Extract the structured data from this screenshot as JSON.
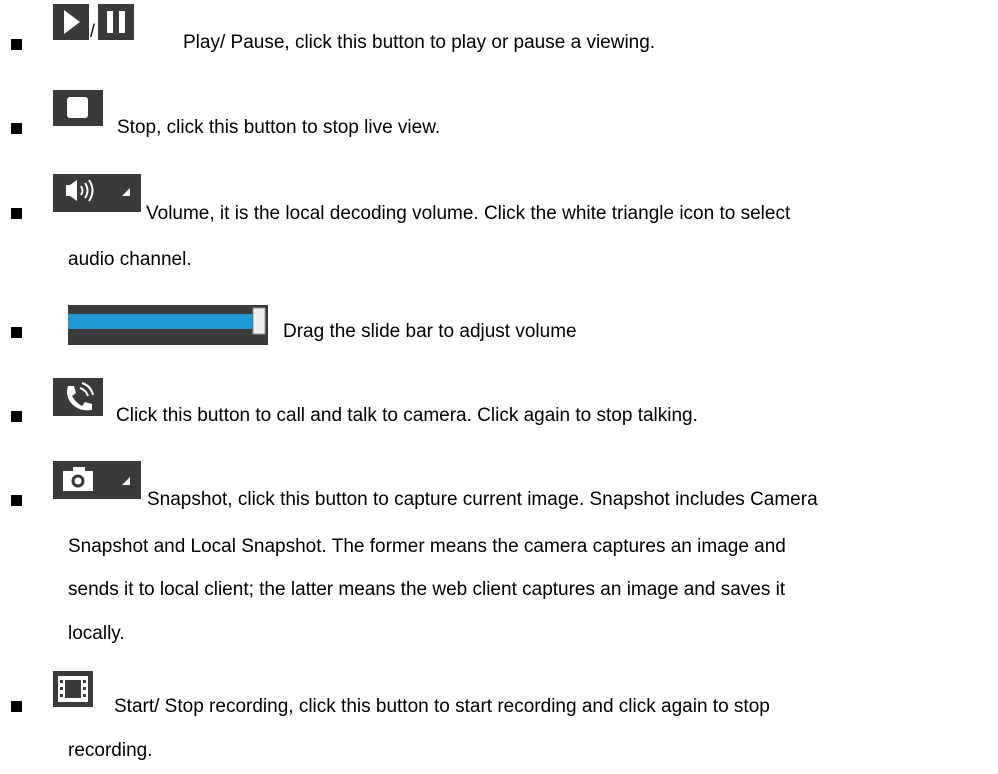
{
  "items": [
    {
      "id": "play-pause",
      "separator": "/",
      "lines": [
        "Play/ Pause, click this button to play or pause a viewing."
      ]
    },
    {
      "id": "stop",
      "lines": [
        "Stop, click this button to stop live view."
      ]
    },
    {
      "id": "volume",
      "lines": [
        "Volume, it is the local decoding volume. Click the white triangle icon to select",
        "audio channel."
      ]
    },
    {
      "id": "volume-slider",
      "slider_fraction": 0.93,
      "lines": [
        "Drag the slide bar to adjust volume"
      ]
    },
    {
      "id": "talk",
      "lines": [
        "Click this button to call and talk to camera. Click again to stop talking."
      ]
    },
    {
      "id": "snapshot",
      "lines": [
        "Snapshot, click this button to capture current image. Snapshot includes Camera",
        "Snapshot and Local Snapshot. The former means the camera captures an image and",
        "sends it to local client; the latter means the web client captures an image and saves it",
        "locally."
      ]
    },
    {
      "id": "record",
      "lines": [
        "Start/ Stop recording, click this button to start recording and click again to stop",
        "recording."
      ]
    }
  ],
  "colors": {
    "icon_bg": "#3a3a3a",
    "slider_fill": "#1b9ad6",
    "icon_fg": "#ffffff"
  },
  "icons": [
    "play-icon",
    "pause-icon",
    "stop-icon",
    "volume-icon",
    "triangle-icon",
    "slider",
    "phone-icon",
    "camera-icon",
    "film-icon"
  ]
}
